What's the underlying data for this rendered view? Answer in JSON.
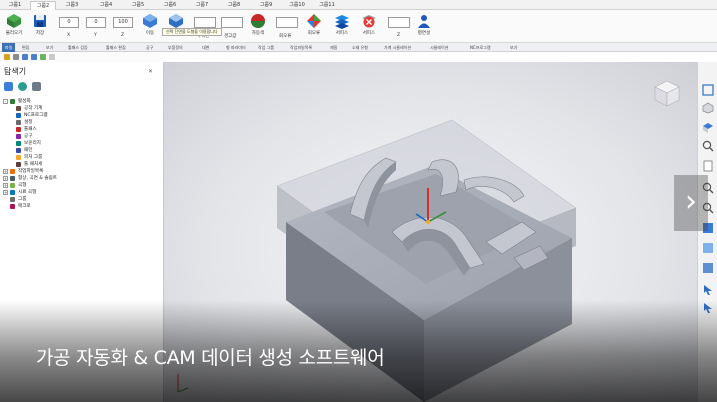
{
  "tabs": [
    "그룹1",
    "그룹2",
    "그룹3",
    "그룹4",
    "그룹5",
    "그룹6",
    "그룹7",
    "그룹8",
    "그룹9",
    "그룹10",
    "그룹11"
  ],
  "ribbon": {
    "b1_label": "불러오기",
    "b2_label": "저장",
    "field1": "0",
    "field2": "0",
    "field3": "100",
    "sub1": "X",
    "sub2": "Y",
    "sub3": "Z",
    "b3_label": "이동",
    "b4_label": "회전",
    "field4": "",
    "field5": "",
    "sub4": "구속판",
    "sub5": "경고값",
    "b5_label": "자동색",
    "field6": "",
    "sub6": "회오류",
    "b6_label": "회오류",
    "b7_label": "서피스",
    "b8_label": "서피스",
    "field7": "",
    "sub7": "Z",
    "b9_label": "평면설",
    "tooltip": "선택 단면을 도형을 이용합니다"
  },
  "strip": {
    "items": [
      "파일",
      "편집",
      "보기",
      "툴패스 검증",
      "툴패스 편집",
      "공구",
      "부품정의",
      "대변",
      "형 파라미터",
      "작업 그룹",
      "작업파일목록",
      "재질",
      "소재 유형",
      "가계 시뮬레이션",
      "시뮬레이션",
      "NC프로그램",
      "보기"
    ]
  },
  "explorer": {
    "title": "탐색기",
    "tree": [
      {
        "label": "활성화",
        "color": "#2e7d32",
        "indent": 1,
        "pm": "-"
      },
      {
        "label": "공작 기계",
        "color": "#6d4c41",
        "indent": 2,
        "pm": ""
      },
      {
        "label": "NC프로그램",
        "color": "#1565c0",
        "indent": 2,
        "pm": ""
      },
      {
        "label": "설정",
        "color": "#6a6a6a",
        "indent": 2,
        "pm": ""
      },
      {
        "label": "툴패스",
        "color": "#c62828",
        "indent": 2,
        "pm": ""
      },
      {
        "label": "공구",
        "color": "#8e24aa",
        "indent": 2,
        "pm": ""
      },
      {
        "label": "보윤리지",
        "color": "#00897b",
        "indent": 2,
        "pm": ""
      },
      {
        "label": "패턴",
        "color": "#3949ab",
        "indent": 2,
        "pm": ""
      },
      {
        "label": "피처 그룹",
        "color": "#f9a825",
        "indent": 2,
        "pm": ""
      },
      {
        "label": "툴 패처세",
        "color": "#5d4037",
        "indent": 2,
        "pm": ""
      },
      {
        "label": "작업파일목록",
        "color": "#ef6c00",
        "indent": 1,
        "pm": "+"
      },
      {
        "label": "형상, 곡면 & 솔림트",
        "color": "#455a64",
        "indent": 1,
        "pm": "+"
      },
      {
        "label": "곡형",
        "color": "#7cb342",
        "indent": 1,
        "pm": "+"
      },
      {
        "label": "시료 곡형",
        "color": "#0277bd",
        "indent": 1,
        "pm": "+"
      },
      {
        "label": "그룹",
        "color": "#6d6d6d",
        "indent": 1,
        "pm": ""
      },
      {
        "label": "매크로",
        "color": "#ad1457",
        "indent": 1,
        "pm": ""
      }
    ]
  },
  "overlay": {
    "caption": "가공 자동화 & CAM 데이터 생성 소프트웨어",
    "next_glyph": "›"
  },
  "colors": {
    "accent": "#3d6fb3",
    "part_top": "#a9adb8",
    "part_side": "#8a8e99",
    "part_front": "#777b86"
  }
}
